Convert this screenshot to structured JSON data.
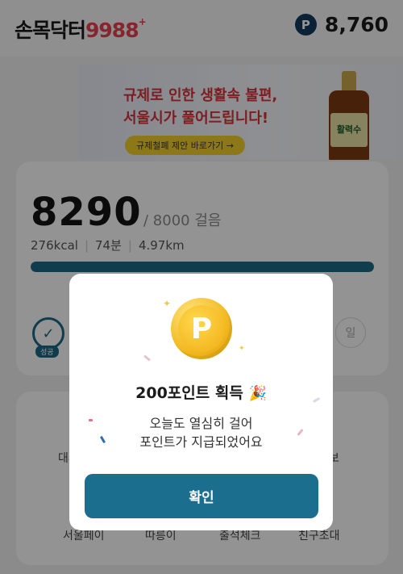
{
  "header": {
    "logo_part1": "손목닥터",
    "logo_part2": "9988",
    "logo_plus": "+",
    "point_badge": "P",
    "point_value": "8,760"
  },
  "banner": {
    "line1": "규제로 인한 생활속 불편,",
    "line2": "서울시가 풀어드립니다!",
    "button_label": "규제철폐 제안 바로가기 →",
    "bottle_label": "활력수"
  },
  "walk_card": {
    "steps": "8290",
    "goal": "/ 8000 걸음",
    "kcal": "276kcal",
    "minutes": "74분",
    "distance": "4.97km",
    "progress_fraction": 1.0,
    "today_badge": "성공",
    "day_right_label": "일"
  },
  "menu": {
    "items": [
      "서울페이",
      "따릉이",
      "출석체크",
      "친구초대"
    ],
    "partial_left": "대시",
    "partial_right": "보"
  },
  "modal": {
    "coin_label": "P",
    "title": "200포인트 획득",
    "party_emoji": "🎉",
    "message_line1": "오늘도 열심히 걸어",
    "message_line2": "포인트가 지급되었어요",
    "confirm_label": "확인"
  },
  "colors": {
    "accent": "#1b6e8d",
    "brand_red": "#ea3f4e",
    "coin_gold": "#f2b81f",
    "dim_overlay": "rgba(0,0,0,0.42)"
  }
}
